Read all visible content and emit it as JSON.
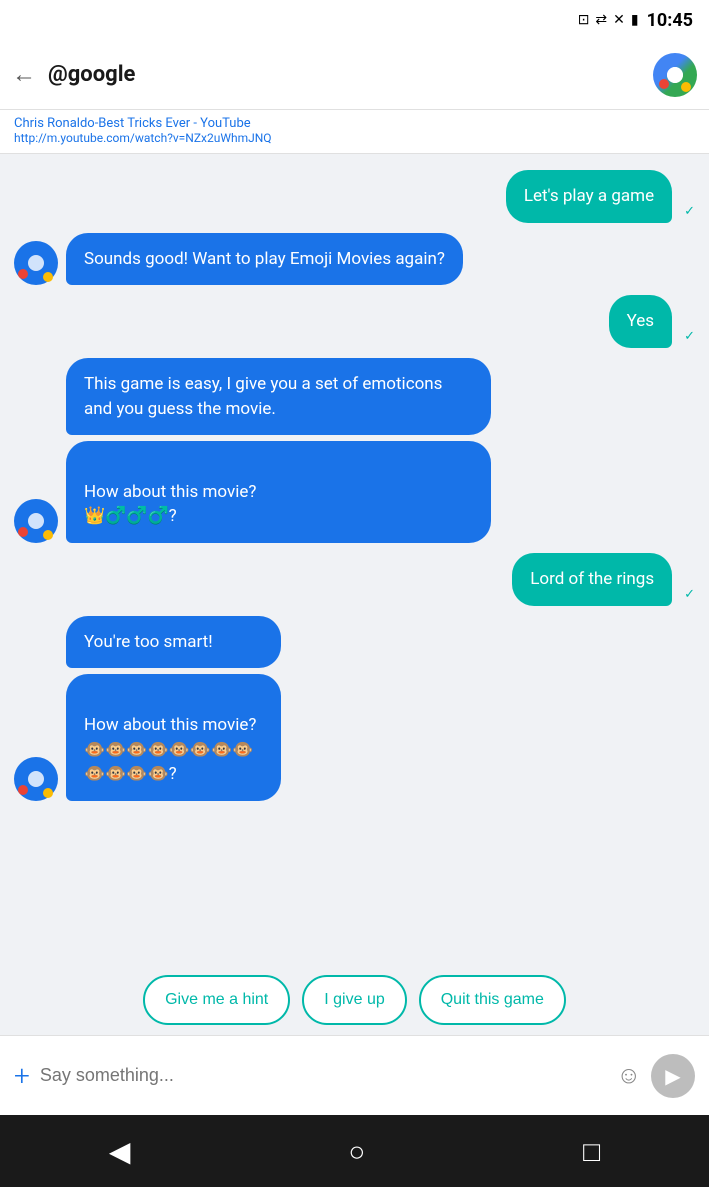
{
  "statusBar": {
    "time": "10:45",
    "icons": [
      "cast",
      "wifi",
      "signal",
      "battery"
    ]
  },
  "topBar": {
    "backLabel": "←",
    "title": "@google",
    "subtitle": "Chris Ronaldo-Best Tricks Ever - YouTube",
    "url": "http://m.youtube.com/watch?v=NZx2uWhmJNQ"
  },
  "messages": [
    {
      "id": 1,
      "type": "sent",
      "text": "Let's play a game",
      "check": true
    },
    {
      "id": 2,
      "type": "received",
      "text": "Sounds good! Want to play Emoji Movies again?"
    },
    {
      "id": 3,
      "type": "sent",
      "text": "Yes",
      "check": true
    },
    {
      "id": 4,
      "type": "received",
      "text": "This game is easy, I give you a set of emoticons and you guess the movie."
    },
    {
      "id": 5,
      "type": "received",
      "text": "How about this movie?\n👑♂️♂️♂️?"
    },
    {
      "id": 6,
      "type": "sent",
      "text": "Lord of the rings",
      "check": true
    },
    {
      "id": 7,
      "type": "received",
      "text": "You're too smart!"
    },
    {
      "id": 8,
      "type": "received",
      "text": "How about this movie?\n🐵🐵🐵🐵🐵🐵🐵🐵🐵🐵🐵🐵?"
    }
  ],
  "actionButtons": [
    {
      "id": "hint",
      "label": "Give me a hint"
    },
    {
      "id": "giveup",
      "label": "I give up"
    },
    {
      "id": "quit",
      "label": "Quit this game"
    }
  ],
  "inputBar": {
    "placeholder": "Say something...",
    "plusLabel": "+",
    "sendLabel": "▶"
  },
  "navBar": {
    "back": "◀",
    "home": "○",
    "recent": "□"
  }
}
